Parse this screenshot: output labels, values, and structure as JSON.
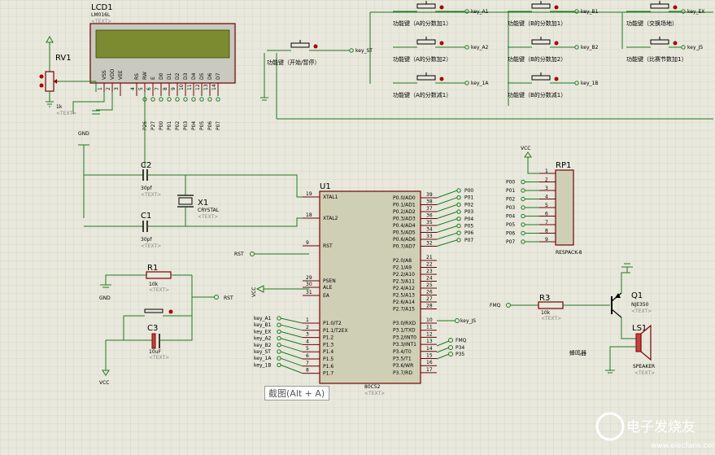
{
  "lcd": {
    "ref": "LCD1",
    "model": "LM016L",
    "text": "<TEXT>",
    "pins": [
      "VSS",
      "VDD",
      "VEE",
      "RS",
      "RW",
      "E",
      "D0",
      "D1",
      "D2",
      "D3",
      "D4",
      "D5",
      "D6",
      "D7"
    ],
    "nums": [
      "1",
      "2",
      "3",
      "4",
      "5",
      "6",
      "7",
      "8",
      "9",
      "10",
      "11",
      "12",
      "13",
      "14"
    ],
    "nets": [
      "P26",
      "P27",
      "P00",
      "P01",
      "P02",
      "P03",
      "P04",
      "P05",
      "P06",
      "P07"
    ]
  },
  "rv1": {
    "ref": "RV1",
    "value": "1k",
    "text": "<TEXT>"
  },
  "gnd": "GND",
  "vcc": "VCC",
  "c2": {
    "ref": "C2",
    "value": "30pf",
    "text": "<TEXT>"
  },
  "c1": {
    "ref": "C1",
    "value": "30pf",
    "text": "<TEXT>"
  },
  "x1": {
    "ref": "X1",
    "value": "CRYSTAL",
    "text": "<TEXT>"
  },
  "r1": {
    "ref": "R1",
    "value": "10k",
    "text": "<TEXT>"
  },
  "c3": {
    "ref": "C3",
    "value": "10uF",
    "text": "<TEXT>"
  },
  "rst": "RST",
  "u1": {
    "ref": "U1",
    "part": "80C52",
    "text": "<TEXT>",
    "left": [
      {
        "n": "19",
        "l": "XTAL1"
      },
      {
        "n": "18",
        "l": "XTAL2"
      },
      {
        "n": "9",
        "l": "RST"
      },
      {
        "n": "29",
        "l": "PSEN"
      },
      {
        "n": "30",
        "l": "ALE"
      },
      {
        "n": "31",
        "l": "EA"
      }
    ],
    "p1": [
      {
        "n": "1",
        "l": "P1.0/T2"
      },
      {
        "n": "2",
        "l": "P1.1/T2EX"
      },
      {
        "n": "3",
        "l": "P1.2"
      },
      {
        "n": "4",
        "l": "P1.3"
      },
      {
        "n": "5",
        "l": "P1.4"
      },
      {
        "n": "6",
        "l": "P1.5"
      },
      {
        "n": "7",
        "l": "P1.6"
      },
      {
        "n": "8",
        "l": "P1.7"
      }
    ],
    "p0": [
      {
        "n": "39",
        "l": "P0.0/AD0"
      },
      {
        "n": "38",
        "l": "P0.1/AD1"
      },
      {
        "n": "37",
        "l": "P0.2/AD2"
      },
      {
        "n": "36",
        "l": "P0.3/AD3"
      },
      {
        "n": "35",
        "l": "P0.4/AD4"
      },
      {
        "n": "34",
        "l": "P0.5/AD5"
      },
      {
        "n": "33",
        "l": "P0.6/AD6"
      },
      {
        "n": "32",
        "l": "P0.7/AD7"
      }
    ],
    "p2": [
      {
        "n": "21",
        "l": "P2.0/A8"
      },
      {
        "n": "22",
        "l": "P2.1/A9"
      },
      {
        "n": "23",
        "l": "P2.2/A10"
      },
      {
        "n": "24",
        "l": "P2.3/A11"
      },
      {
        "n": "25",
        "l": "P2.4/A12"
      },
      {
        "n": "26",
        "l": "P2.5/A13"
      },
      {
        "n": "27",
        "l": "P2.6/A14"
      },
      {
        "n": "28",
        "l": "P2.7/A15"
      }
    ],
    "p3": [
      {
        "n": "10",
        "l": "P3.0/RXD"
      },
      {
        "n": "11",
        "l": "P3.1/TXD"
      },
      {
        "n": "12",
        "l": "P3.2/INT0"
      },
      {
        "n": "13",
        "l": "P3.3/INT1"
      },
      {
        "n": "14",
        "l": "P3.4/T0"
      },
      {
        "n": "15",
        "l": "P3.5/T1"
      },
      {
        "n": "16",
        "l": "P3.6/WR"
      },
      {
        "n": "17",
        "l": "P3.7/RD"
      }
    ]
  },
  "p1nets": [
    "key_A1",
    "key_B1",
    "key_EX",
    "key_A2",
    "key_B2",
    "key_ST",
    "key_1A",
    "key_1B"
  ],
  "p0nets": [
    "P00",
    "P01",
    "P02",
    "P03",
    "P04",
    "P05",
    "P06",
    "P07"
  ],
  "p3nets": {
    "rx": "key_JS",
    "fmq": "FMQ",
    "p34": "P34",
    "p35": "P35"
  },
  "rp1": {
    "ref": "RP1",
    "part": "RESPACK-8",
    "pins": [
      "1",
      "2",
      "3",
      "4",
      "5",
      "6",
      "7",
      "8",
      "9"
    ],
    "nets": [
      "P00",
      "P01",
      "P02",
      "P03",
      "P04",
      "P05",
      "P06",
      "P07"
    ]
  },
  "r3": {
    "ref": "R3",
    "value": "10k",
    "text": "<TEXT>",
    "net": "FMQ"
  },
  "q1": {
    "ref": "Q1",
    "part": "NJE350",
    "text": "<TEXT>"
  },
  "ls1": {
    "ref": "LS1",
    "part": "SPEAKER",
    "text": "<TEXT>"
  },
  "buzzer_label": "蜂鸣器",
  "sw_start": {
    "label": "功能键（开始/暂停）",
    "net": "key_ST"
  },
  "switches_a": [
    {
      "label": "功能键（A的分数加1）",
      "net": "key_A1"
    },
    {
      "label": "功能键（A的分数加2）",
      "net": "key_A2"
    },
    {
      "label": "功能键（A的分数减1）",
      "net": "key_1A"
    }
  ],
  "switches_b": [
    {
      "label": "功能键（B的分数加1）",
      "net": "key_B1"
    },
    {
      "label": "功能键（B的分数加2）",
      "net": "key_B2"
    },
    {
      "label": "功能键（B的分数减1）",
      "net": "key_1B"
    }
  ],
  "switches_c": [
    {
      "label": "功能键（交换场地）",
      "net": "key_EX"
    },
    {
      "label": "功能键（比赛节数加1）",
      "net": "key_JS"
    }
  ],
  "tooltip": "截图(Alt + A)",
  "watermark": {
    "cn": "电子发烧友",
    "url": "www.elecfans.com"
  }
}
